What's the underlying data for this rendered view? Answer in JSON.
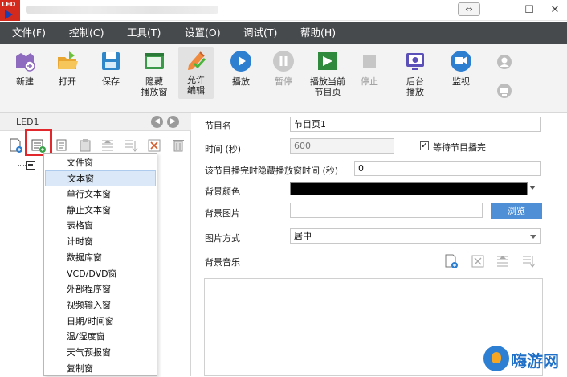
{
  "titlebar": {
    "logo_text": "LED",
    "restore_glyph": "⇔",
    "min_glyph": "—",
    "max_glyph": "☐",
    "close_glyph": "✕"
  },
  "menu": [
    "文件(F)",
    "控制(C)",
    "工具(T)",
    "设置(O)",
    "调试(T)",
    "帮助(H)"
  ],
  "toolbar": [
    {
      "id": "new",
      "label": "新建",
      "icon": "new-file-icon"
    },
    {
      "id": "open",
      "label": "打开",
      "icon": "open-folder-icon"
    },
    {
      "id": "save",
      "label": "保存",
      "icon": "save-disk-icon"
    },
    {
      "id": "hide-window",
      "label": "隐藏\n播放窗",
      "icon": "hide-window-icon"
    },
    {
      "id": "allow-edit",
      "label": "允许\n编辑",
      "icon": "edit-pencil-icon"
    },
    {
      "id": "play",
      "label": "播放",
      "icon": "play-icon"
    },
    {
      "id": "pause",
      "label": "暂停",
      "icon": "pause-icon"
    },
    {
      "id": "play-current",
      "label": "播放当前\n节目页",
      "icon": "play-current-icon"
    },
    {
      "id": "stop",
      "label": "停止",
      "icon": "stop-icon"
    },
    {
      "id": "background-play",
      "label": "后台\n播放",
      "icon": "background-play-icon"
    },
    {
      "id": "monitor",
      "label": "监视",
      "icon": "monitor-icon"
    }
  ],
  "left_panel": {
    "led_label": "LED1",
    "prev_glyph": "◀",
    "next_glyph": "▶"
  },
  "dropdown": {
    "items": [
      "文件窗",
      "文本窗",
      "单行文本窗",
      "静止文本窗",
      "表格窗",
      "计时窗",
      "数据库窗",
      "VCD/DVD窗",
      "外部程序窗",
      "视频输入窗",
      "日期/时间窗",
      "温/湿度窗",
      "天气预报窗",
      "复制窗"
    ],
    "selected_index": 1
  },
  "props": {
    "name_label": "节目名",
    "name_value": "节目页1",
    "time_label": "时间 (秒)",
    "time_value": "600",
    "wait_label": "等待节目播完",
    "wait_checked": true,
    "check_glyph": "✓",
    "hide_time_label": "该节目播完时隐藏播放窗时间 (秒)",
    "hide_time_value": "0",
    "bgcolor_label": "背景颜色",
    "bgcolor_value": "#000000",
    "bgimage_label": "背景图片",
    "bgimage_value": "",
    "browse_label": "浏览",
    "image_mode_label": "图片方式",
    "image_mode_value": "居中",
    "bgmusic_label": "背景音乐"
  },
  "watermark": {
    "text": "嗨游网"
  }
}
